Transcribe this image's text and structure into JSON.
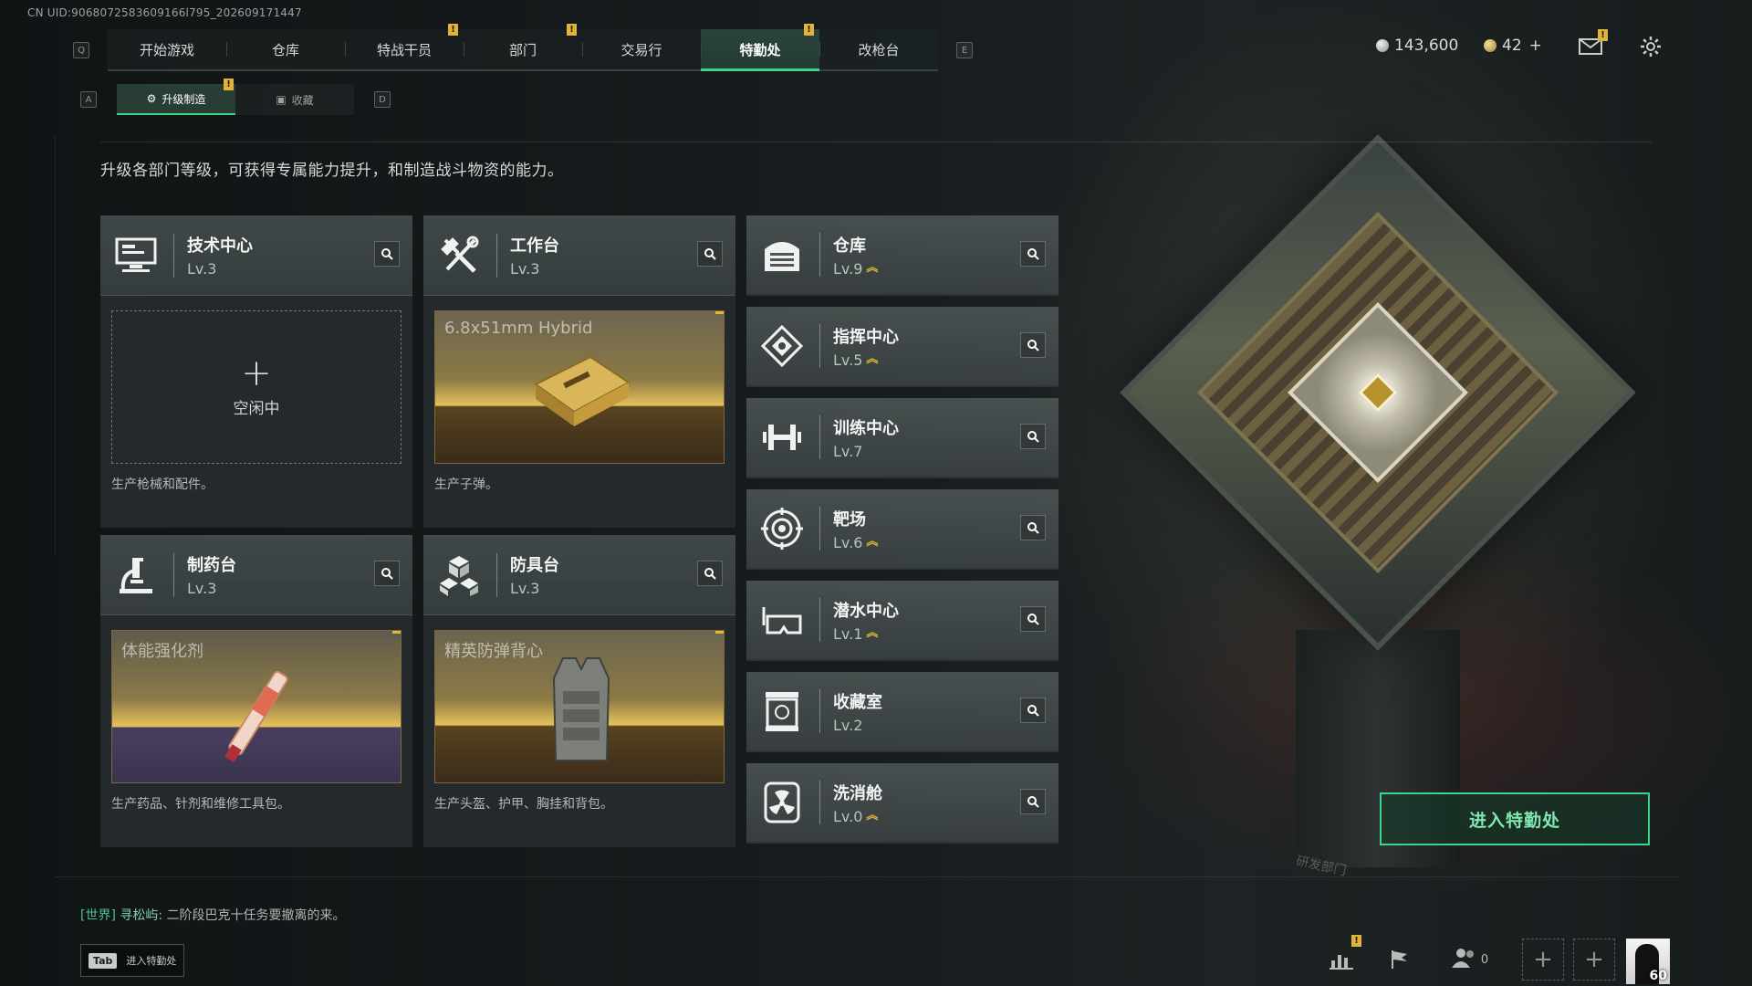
{
  "uid": "CN UID:9068072583609166l795_202609171447",
  "nav": {
    "left_key": "Q",
    "right_key": "E",
    "tabs": [
      {
        "label": "开始游戏",
        "alert": false
      },
      {
        "label": "仓库",
        "alert": false
      },
      {
        "label": "特战干员",
        "alert": true
      },
      {
        "label": "部门",
        "alert": true
      },
      {
        "label": "交易行",
        "alert": false
      },
      {
        "label": "特勤处",
        "alert": true,
        "active": true
      },
      {
        "label": "改枪台",
        "alert": false
      }
    ]
  },
  "currency": {
    "silver": "143,600",
    "gold": "42",
    "gold_add": "+"
  },
  "subnav": {
    "left_key": "A",
    "right_key": "D",
    "tabs": [
      {
        "label": "升级制造",
        "active": true,
        "alert": true
      },
      {
        "label": "收藏",
        "active": false
      }
    ]
  },
  "description": "升级各部门等级，可获得专属能力提升，和制造战斗物资的能力。",
  "alert_mark": "!",
  "facilities_main": [
    {
      "name": "技术中心",
      "level": "Lv.3",
      "icon": "monitor-icon",
      "slot_state": "idle",
      "slot_text": "空闲中",
      "note": "生产枪械和配件。"
    },
    {
      "name": "工作台",
      "level": "Lv.3",
      "icon": "hammer-wrench-icon",
      "slot_state": "product",
      "product": "6.8x51mm Hybrid",
      "note": "生产子弹。"
    },
    {
      "name": "制药台",
      "level": "Lv.3",
      "icon": "microscope-icon",
      "slot_state": "product",
      "product": "体能强化剂",
      "note": "生产药品、针剂和维修工具包。"
    },
    {
      "name": "防具台",
      "level": "Lv.3",
      "icon": "cubes-icon",
      "slot_state": "product",
      "product": "精英防弹背心",
      "note": "生产头盔、护甲、胸挂和背包。"
    }
  ],
  "facilities_side": [
    {
      "name": "仓库",
      "level": "Lv.9",
      "icon": "warehouse-icon",
      "upgradable": true
    },
    {
      "name": "指挥中心",
      "level": "Lv.5",
      "icon": "command-icon",
      "upgradable": true
    },
    {
      "name": "训练中心",
      "level": "Lv.7",
      "icon": "dumbbell-icon",
      "upgradable": false
    },
    {
      "name": "靶场",
      "level": "Lv.6",
      "icon": "target-icon",
      "upgradable": true
    },
    {
      "name": "潜水中心",
      "level": "Lv.1",
      "icon": "diving-mask-icon",
      "upgradable": true
    },
    {
      "name": "收藏室",
      "level": "Lv.2",
      "icon": "collection-icon",
      "upgradable": false
    },
    {
      "name": "洗消舱",
      "level": "Lv.0",
      "icon": "radiation-icon",
      "upgradable": true
    }
  ],
  "enter_button": "进入特勤处",
  "chat": {
    "channel": "[世界]",
    "sender": "寻松屿:",
    "message": "二阶段巴克十任务要撤离的来。"
  },
  "tab_hint": {
    "key": "Tab",
    "label": "进入特勤处"
  },
  "friends_count": "0",
  "avatar_level": "60",
  "art_logo": "研发部门",
  "colors": {
    "accent": "#3fd48c",
    "alert": "#e0b33a"
  }
}
